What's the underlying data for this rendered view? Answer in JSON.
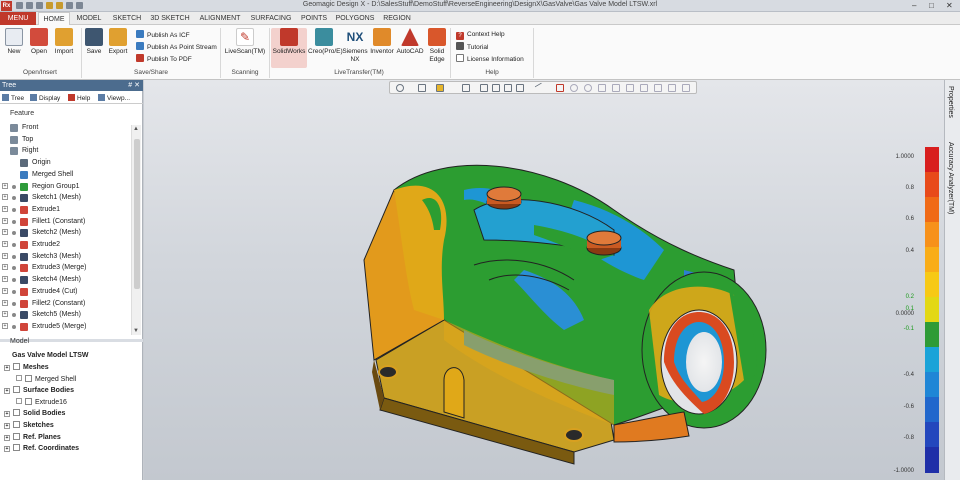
{
  "app": {
    "logo": "Rx",
    "title": "Geomagic Design X - D:\\SalesStuff\\DemoStuff\\ReverseEngineering\\DesignX\\GasValve\\Gas Valve Model LTSW.xrl",
    "win_controls": [
      "–",
      "□",
      "✕"
    ]
  },
  "menu_tabs": [
    "MENU",
    "HOME",
    "MODEL",
    "SKETCH",
    "3D SKETCH",
    "ALIGNMENT",
    "SURFACING",
    "POINTS",
    "POLYGONS",
    "REGION"
  ],
  "ribbon": {
    "groups": [
      "Open/Insert",
      "Save/Share",
      "Scanning",
      "LiveTransfer(TM)",
      "Help"
    ],
    "open_insert": [
      "New",
      "Open",
      "Import"
    ],
    "save_share_big": [
      "Save",
      "Export"
    ],
    "save_share_small": [
      "Publish As ICF",
      "Publish As Point Stream",
      "Publish To PDF"
    ],
    "scanning": "LiveScan(TM)",
    "livetransfer": [
      "SolidWorks",
      "Creo(Pro/E)",
      "Siemens NX",
      "Inventor",
      "AutoCAD",
      "Solid Edge"
    ],
    "help": [
      "Context Help",
      "Tutorial",
      "License Information"
    ]
  },
  "panel": {
    "title": "Tree",
    "pin": "# ✕",
    "tabs": [
      "Tree",
      "Display",
      "Help",
      "Viewp..."
    ],
    "feature_header": "Feature",
    "features": [
      {
        "label": "Front",
        "color": "#7b8a9a"
      },
      {
        "label": "Top",
        "color": "#7b8a9a"
      },
      {
        "label": "Right",
        "color": "#7b8a9a"
      },
      {
        "label": "Origin",
        "color": "#5b6a7a"
      },
      {
        "label": "Merged Shell",
        "color": "#3b7bbf"
      },
      {
        "label": "Region Group1",
        "color": "#2e9b3a"
      },
      {
        "label": "Sketch1 (Mesh)",
        "color": "#3a4a66"
      },
      {
        "label": "Extrude1",
        "color": "#d0453a"
      },
      {
        "label": "Fillet1 (Constant)",
        "color": "#d0453a"
      },
      {
        "label": "Sketch2 (Mesh)",
        "color": "#3a4a66"
      },
      {
        "label": "Extrude2",
        "color": "#d0453a"
      },
      {
        "label": "Sketch3 (Mesh)",
        "color": "#3a4a66"
      },
      {
        "label": "Extrude3 (Merge)",
        "color": "#d0453a"
      },
      {
        "label": "Sketch4 (Mesh)",
        "color": "#3a4a66"
      },
      {
        "label": "Extrude4 (Cut)",
        "color": "#d0453a"
      },
      {
        "label": "Fillet2 (Constant)",
        "color": "#d0453a"
      },
      {
        "label": "Sketch5 (Mesh)",
        "color": "#3a4a66"
      },
      {
        "label": "Extrude5 (Merge)",
        "color": "#d0453a"
      }
    ],
    "model_header": "Model",
    "model_title": "Gas Valve Model LTSW",
    "model_items": [
      {
        "label": "Meshes",
        "bold": true
      },
      {
        "label": "Merged Shell",
        "bold": false
      },
      {
        "label": "Surface Bodies",
        "bold": true
      },
      {
        "label": "Extrude16",
        "bold": false
      },
      {
        "label": "Solid Bodies",
        "bold": true
      },
      {
        "label": "Sketches",
        "bold": true
      },
      {
        "label": "Ref. Planes",
        "bold": true
      },
      {
        "label": "Ref. Coordinates",
        "bold": true
      }
    ]
  },
  "right_tabs": [
    "Properties",
    "Accuracy Analyzer(TM)"
  ],
  "color_scale": {
    "labels": [
      "1.0000",
      "0.8",
      "0.6",
      "0.4",
      "0.2",
      "0.1",
      "0.0000",
      "-0.1",
      "-0.4",
      "-0.6",
      "-0.8",
      "-1.0000"
    ],
    "colors": [
      "#d81e1e",
      "#e84a1a",
      "#f06a16",
      "#f7911a",
      "#f9ad18",
      "#f7c915",
      "#e3d814",
      "#2e9b36",
      "#1aa3d8",
      "#1f86d6",
      "#2167cc",
      "#2347bd",
      "#1f2fa8"
    ]
  }
}
